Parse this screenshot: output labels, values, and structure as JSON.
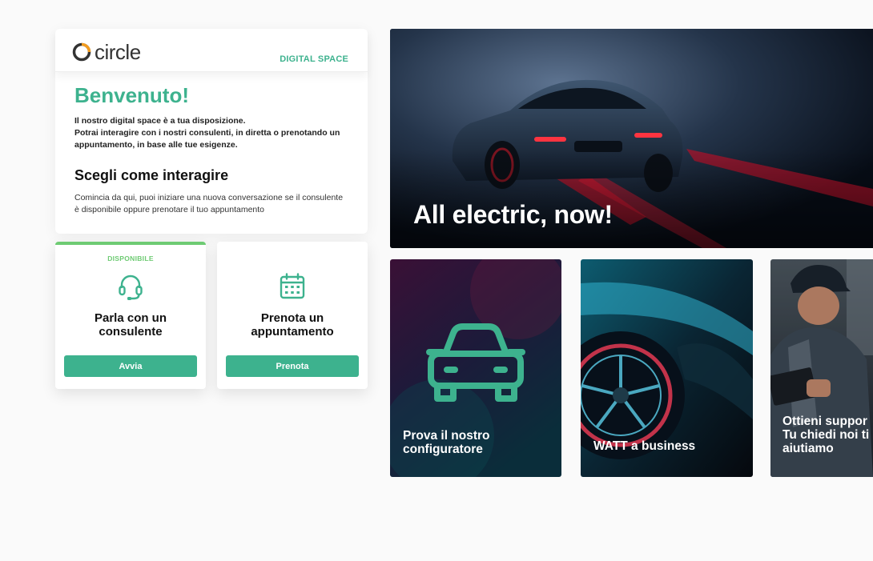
{
  "brand": {
    "logo_text": "circle",
    "section_label": "DIGITAL SPACE",
    "colors": {
      "accent": "#3db28e",
      "available": "#6ecb73",
      "logo_orange": "#f39c1f"
    }
  },
  "welcome": {
    "title": "Benvenuto!",
    "intro_line1": "Il nostro digital space è a tua disposizione.",
    "intro_line2": "Potrai interagire con i nostri consulenti, in diretta o prenotando un appuntamento, in base alle tue esigenze.",
    "choose_title": "Scegli come interagire",
    "choose_text": "Comincia da qui, puoi iniziare una nuova conversazione se il consulente è disponibile oppure prenotare il tuo appuntamento"
  },
  "actions": [
    {
      "status": "DISPONIBILE",
      "title": "Parla con un consulente",
      "button": "Avvia",
      "icon": "headset-icon"
    },
    {
      "title": "Prenota un appuntamento",
      "button": "Prenota",
      "icon": "calendar-icon"
    }
  ],
  "hero": {
    "title": "All electric, now!"
  },
  "tiles": [
    {
      "label": "Prova il nostro\nconfiguratore",
      "icon": "car-icon"
    },
    {
      "label": "WATT a business"
    },
    {
      "label": "Ottieni suppor\nTu chiedi noi ti\naiutiamo"
    }
  ]
}
